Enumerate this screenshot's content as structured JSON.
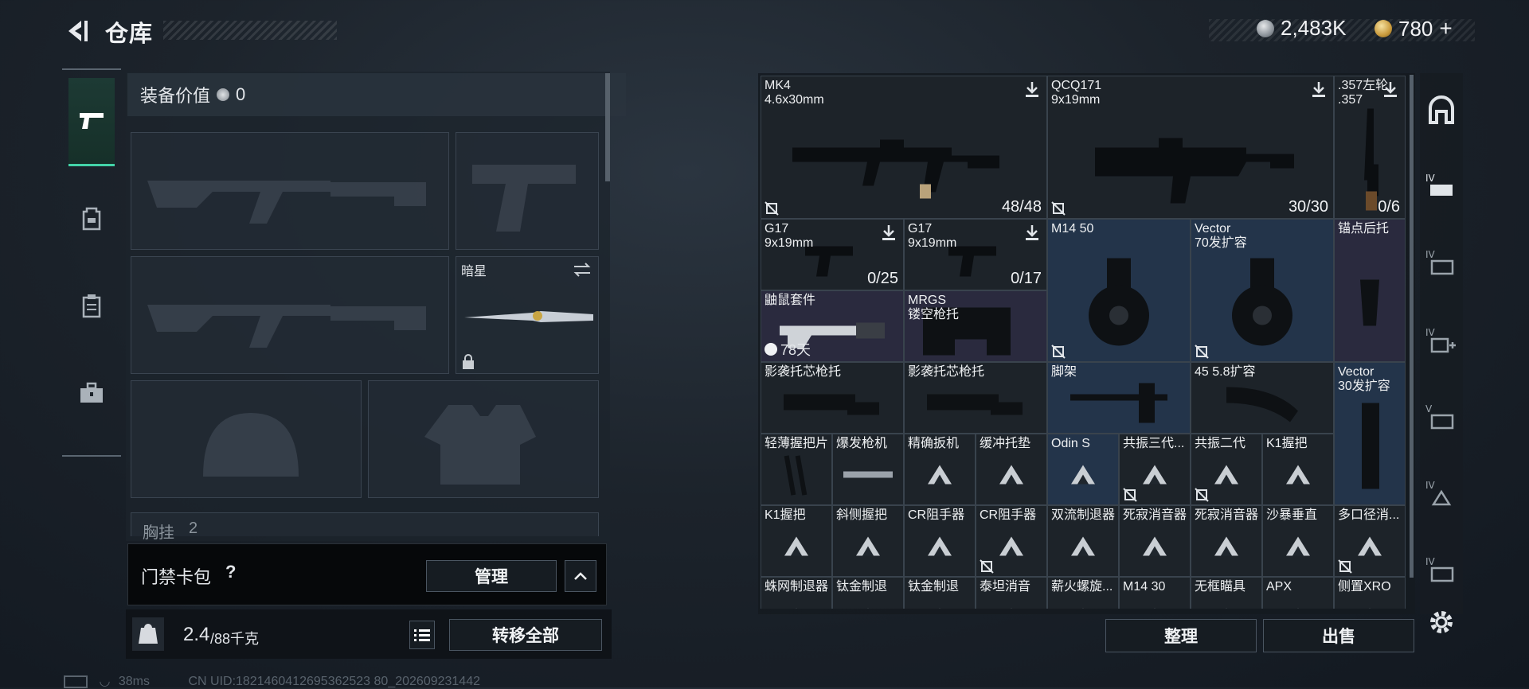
{
  "header": {
    "title": "仓库"
  },
  "currency": {
    "silver": "2,483K",
    "gold": "780",
    "plus": "+"
  },
  "loadout": {
    "equip_value_label": "装备价值",
    "equip_value": "0",
    "melee_name": "暗星",
    "chest_label": "胸挂",
    "chest_count": "2"
  },
  "keycard": {
    "label": "门禁卡包",
    "help": "?",
    "manage": "管理"
  },
  "weight": {
    "current": "2.4",
    "max": "/88千克",
    "kg_icon": "KG",
    "transfer_all": "转移全部"
  },
  "status": {
    "ping": "38ms",
    "uid": "CN UID:1821460412695362523 80_202609231442"
  },
  "grid_items": [
    {
      "name": "MK4",
      "sub": "4.6x30mm",
      "count": "48/48"
    },
    {
      "name": "QCQ171",
      "sub": "9x19mm",
      "count": "30/30"
    },
    {
      "name": ".357左轮",
      "sub": ".357",
      "count": "0/6"
    },
    {
      "name": "G17",
      "sub": "9x19mm",
      "count": "0/25"
    },
    {
      "name": "G17",
      "sub": "9x19mm",
      "count": "0/17"
    },
    {
      "name": "M14 50",
      "sub": ""
    },
    {
      "name": "Vector",
      "sub": "70发扩容"
    },
    {
      "name": "锚点后托",
      "sub": ""
    },
    {
      "name": "鼬鼠套件",
      "sub": "",
      "timer": "78天"
    },
    {
      "name": "MRGS",
      "sub": "镂空枪托"
    },
    {
      "name": "影袭托芯枪托",
      "sub": ""
    },
    {
      "name": "影袭托芯枪托",
      "sub": ""
    },
    {
      "name": "脚架",
      "sub": ""
    },
    {
      "name": "45 5.8扩容",
      "sub": ""
    },
    {
      "name": "Vector",
      "sub": "30发扩容"
    },
    {
      "name": "轻薄握把片"
    },
    {
      "name": "爆发枪机"
    },
    {
      "name": "精确扳机"
    },
    {
      "name": "缓冲托垫"
    },
    {
      "name": "Odin S"
    },
    {
      "name": "共振三代..."
    },
    {
      "name": "共振二代"
    },
    {
      "name": "K1握把"
    },
    {
      "name": "K1握把"
    },
    {
      "name": "斜侧握把"
    },
    {
      "name": "CR阻手器"
    },
    {
      "name": "CR阻手器"
    },
    {
      "name": "双流制退器"
    },
    {
      "name": "死寂消音器"
    },
    {
      "name": "死寂消音器"
    },
    {
      "name": "沙暴垂直"
    },
    {
      "name": "多口径消..."
    },
    {
      "name": "蛛网制退器"
    },
    {
      "name": "钛金制退"
    },
    {
      "name": "钛金制退"
    },
    {
      "name": "泰坦消音"
    },
    {
      "name": "薪火螺旋..."
    },
    {
      "name": "M14 30"
    },
    {
      "name": "无框瞄具"
    },
    {
      "name": "APX"
    },
    {
      "name": "侧置XRO"
    }
  ],
  "actions": {
    "sort": "整理",
    "sell": "出售"
  },
  "colors": {
    "accent": "#43d3a8",
    "epic": "#2a2a3e",
    "rare": "#23344a"
  }
}
